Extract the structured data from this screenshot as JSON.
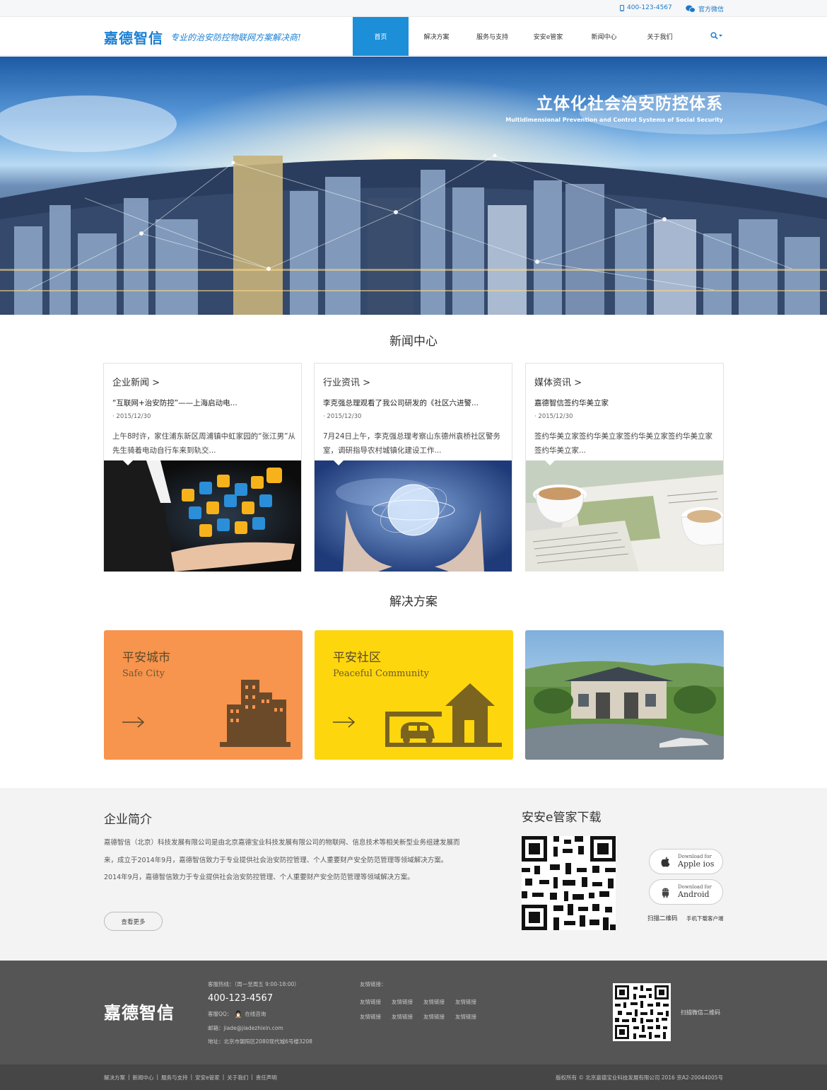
{
  "topbar": {
    "phone": "400-123-4567",
    "wechat": "官方微信"
  },
  "header": {
    "logo_name": "嘉德智信",
    "slogan": "专业的治安防控物联网方案解决商!",
    "nav": [
      "首页",
      "解决方案",
      "服务与支持",
      "安安e管家",
      "新闻中心",
      "关于我们"
    ],
    "active_nav": "首页"
  },
  "hero": {
    "title": "立体化社会治安防控体系",
    "subtitle": "Multidimensional Prevention and Control Systems of Social Security"
  },
  "news": {
    "section_title": "新闻中心",
    "cards": [
      {
        "category": "企业新闻 >",
        "headline": "“互联网+治安防控”——上海启动电...",
        "date": "2015/12/30",
        "excerpt": "上午8时许，家住浦东新区周浦镇中虹家园的“张江男”从先生骑着电动自行车来到轨交...",
        "image": "hand-holding-app-icons"
      },
      {
        "category": "行业资讯 >",
        "headline": "李克强总理观看了我公司研发的《社区六进警...",
        "date": "2015/12/30",
        "excerpt": "7月24日上午，李克强总理考察山东德州袁桥社区警务室，调研指导农村城镇化建设工作...",
        "image": "hands-holding-globe"
      },
      {
        "category": "媒体资讯 >",
        "headline": "嘉德智信签约华美立家",
        "date": "2015/12/30",
        "excerpt": "签约华美立家签约华美立家签约华美立家签约华美立家签约华美立家...",
        "image": "coffee-and-newspapers"
      }
    ]
  },
  "solutions": {
    "section_title": "解决方案",
    "cards": [
      {
        "title_cn": "平安城市",
        "title_en": "Safe City",
        "color": "#f7944d"
      },
      {
        "title_cn": "平安社区",
        "title_en": "Peaceful Community",
        "color": "#fdd60e"
      },
      {
        "image": "villa-photo"
      }
    ]
  },
  "intro": {
    "title": "企业简介",
    "paragraphs": [
      "嘉德智信（北京）科技发展有限公司是由北京嘉德宝业科技发展有限公司的物联网、信息技术等相关新型业务组建发展而来，成立于2014年9月，嘉德智信致力于专业提供社会治安防控管理、个人重要财产安全防范管理等领域解决方案。",
      "2014年9月，嘉德智信致力于专业提供社会治安防控管理、个人重要财产安全防范管理等领域解决方案。"
    ],
    "more_label": "查看更多"
  },
  "download": {
    "title": "安安e管家下载",
    "apple_small": "Download for",
    "apple_big": "Apple ios",
    "android_small": "Download for",
    "android_big": "Android",
    "scan_caption": "扫描二维码",
    "client_caption": "手机下载客户端"
  },
  "footer": {
    "logo": "嘉德智信",
    "hotline_label": "客服热线：（周一至周五 9:00-18:00）",
    "hotline": "400-123-4567",
    "qq_label": "客服QQ：",
    "qq_text": "在线咨询",
    "email": "邮箱：jiade@jiadezhixin.com",
    "address": "地址：北京市朝阳区2080现代城6号楼3208",
    "links_label": "友情链接：",
    "links": [
      "友情链接",
      "友情链接",
      "友情链接",
      "友情链接",
      "友情链接",
      "友情链接",
      "友情链接",
      "友情链接"
    ],
    "qr_caption": "扫描微信二维码"
  },
  "bottombar": {
    "links": [
      "解决方案",
      "新闻中心",
      "服务与支持",
      "安安e管家",
      "关于我们",
      "责任声明"
    ],
    "copyright": "版权所有 © 北京嘉德宝业科技发展有限公司 2016 京A2-20044005号"
  }
}
